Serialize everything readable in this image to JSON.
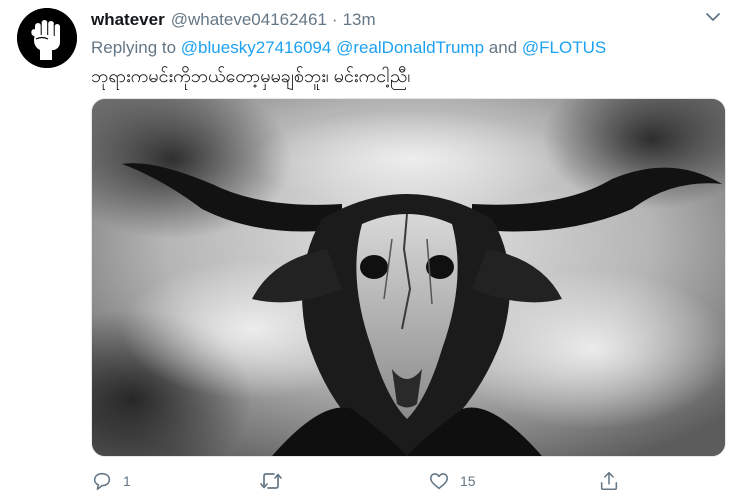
{
  "user": {
    "display_name": "whatever",
    "handle": "@whateve04162461",
    "separator": "·",
    "timestamp": "13m",
    "avatar_icon": "raised-fist-icon"
  },
  "reply_context": {
    "prefix": "Replying to",
    "mention_1": "@bluesky27416094",
    "mention_2": "@realDonaldTrump",
    "conjunction": "and",
    "mention_3": "@FLOTUS"
  },
  "tweet": {
    "text": "ဘုရားကမင်းကိုဘယ်တော့မှမချစ်ဘူး၊ မင်းကငါ့ညီ၊",
    "media_description_icon": "goat-skull-photo"
  },
  "actions": {
    "reply_count": "1",
    "retweet_count": "",
    "like_count": "15",
    "share_count": ""
  },
  "colors": {
    "accent": "#1da1f2",
    "muted": "#657786",
    "text": "#14171a"
  }
}
